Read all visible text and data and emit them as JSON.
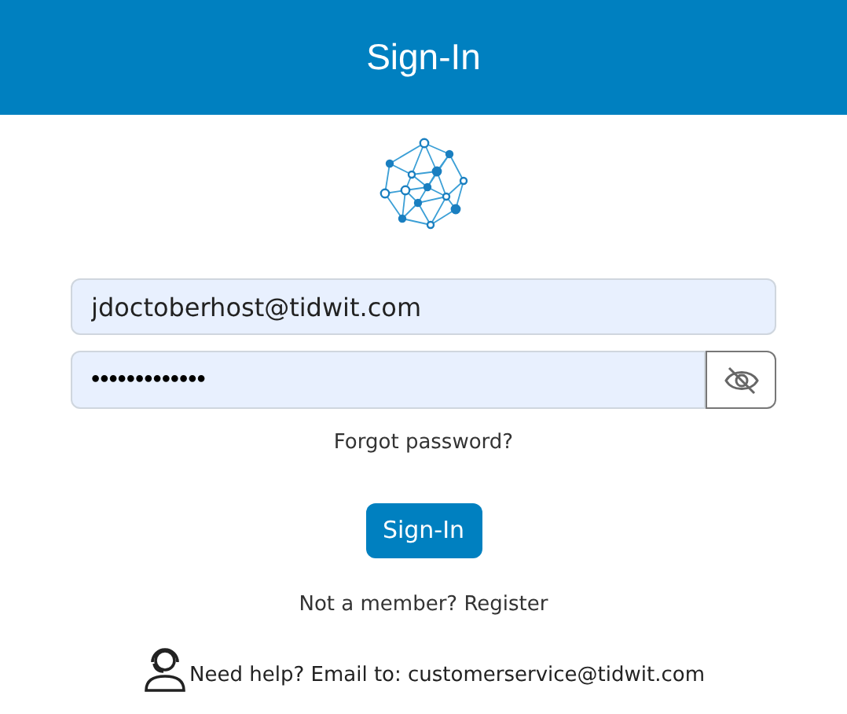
{
  "header": {
    "title": "Sign-In"
  },
  "form": {
    "email": {
      "value": "jdoctoberhost@tidwit.com"
    },
    "password": {
      "value": "•••••••••••••"
    },
    "forgot_link": "Forgot password?",
    "submit": "Sign-In",
    "register_text": "Not a member? Register",
    "help_text": "Need help? Email to: customerservice@tidwit.com"
  }
}
